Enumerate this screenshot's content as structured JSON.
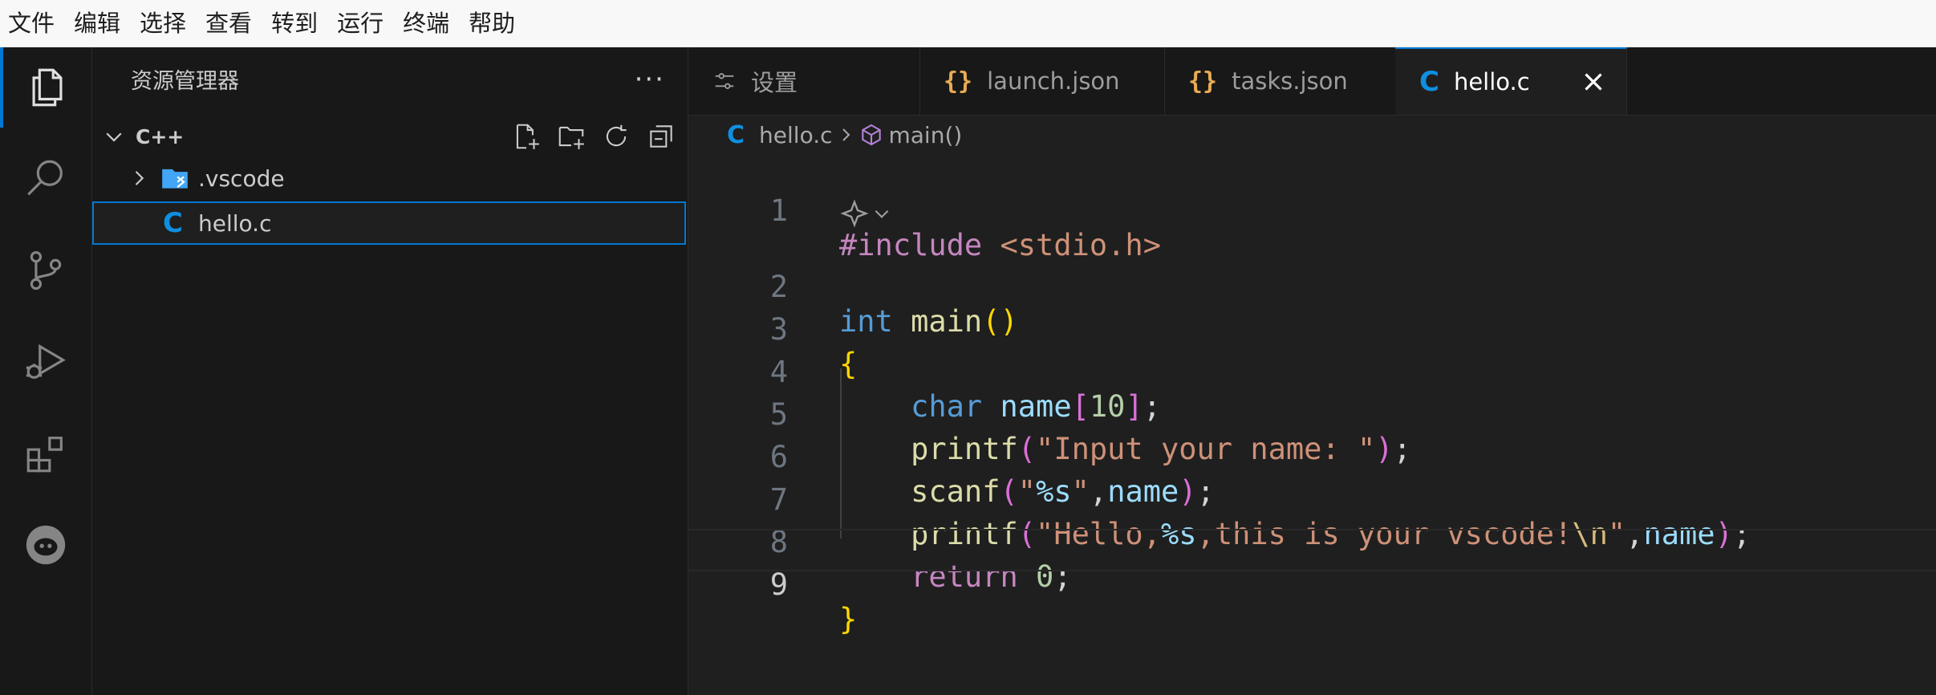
{
  "menu": [
    "文件",
    "编辑",
    "选择",
    "查看",
    "转到",
    "运行",
    "终端",
    "帮助"
  ],
  "sidebar": {
    "title": "资源管理器",
    "more": "···",
    "section": "C++",
    "items": [
      ".vscode",
      "hello.c"
    ]
  },
  "tabs": [
    {
      "label": "设置",
      "icon": "settings-icon"
    },
    {
      "label": "launch.json",
      "icon": "json-braces-icon"
    },
    {
      "label": "tasks.json",
      "icon": "json-braces-icon"
    },
    {
      "label": "hello.c",
      "icon": "c-file-icon",
      "active": true
    }
  ],
  "breadcrumbs": {
    "file": "hello.c",
    "symbol": "main()"
  },
  "code": {
    "line_numbers": [
      "1",
      "2",
      "3",
      "4",
      "5",
      "6",
      "7",
      "8",
      "9"
    ],
    "l1_pp": "#include",
    "l1_inc": "<stdio.h>",
    "l2_kw": "int",
    "l2_fn": "main",
    "l4_kw": "char",
    "l4_var": "name",
    "l4_num": "10",
    "l5_fn": "printf",
    "l5_str": "\"Input your name: \"",
    "l6_fn": "scanf",
    "l6_q1": "\"",
    "l6_fmt": "%s",
    "l6_q2": "\"",
    "l6_var": "name",
    "l7_fn": "printf",
    "l7_str1": "\"Hello,",
    "l7_fmt": "%s",
    "l7_str2": ",this is your vscode!",
    "l7_esc": "\\n",
    "l7_str3": "\"",
    "l7_var": "name",
    "l8_ctl": "return",
    "l8_num": "0"
  },
  "colors": {
    "accent": "#0078d4",
    "json_icon": "#e8ab53",
    "c_icon": "#0e8fe0"
  }
}
